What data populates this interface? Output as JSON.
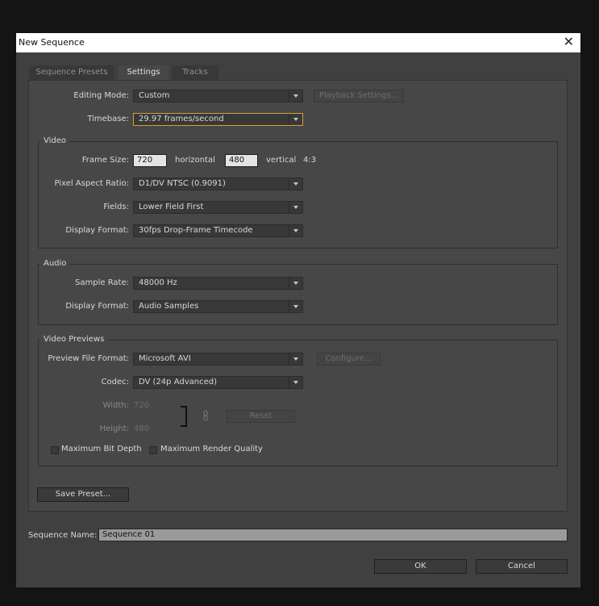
{
  "window": {
    "title": "New Sequence"
  },
  "tabs": [
    {
      "label": "Sequence Presets",
      "active": false
    },
    {
      "label": "Settings",
      "active": true
    },
    {
      "label": "Tracks",
      "active": false
    }
  ],
  "general": {
    "editing_mode_label": "Editing Mode:",
    "editing_mode_value": "Custom",
    "playback_settings_label": "Playback Settings...",
    "timebase_label": "Timebase:",
    "timebase_value": "29.97 frames/second"
  },
  "video": {
    "legend": "Video",
    "frame_size_label": "Frame Size:",
    "frame_width": "720",
    "horizontal_label": "horizontal",
    "frame_height": "480",
    "vertical_label": "vertical",
    "aspect": "4:3",
    "pixel_aspect_label": "Pixel Aspect Ratio:",
    "pixel_aspect_value": "D1/DV NTSC (0.9091)",
    "fields_label": "Fields:",
    "fields_value": "Lower Field First",
    "display_format_label": "Display Format:",
    "display_format_value": "30fps Drop-Frame Timecode"
  },
  "audio": {
    "legend": "Audio",
    "sample_rate_label": "Sample Rate:",
    "sample_rate_value": "48000 Hz",
    "display_format_label": "Display Format:",
    "display_format_value": "Audio Samples"
  },
  "previews": {
    "legend": "Video Previews",
    "file_format_label": "Preview File Format:",
    "file_format_value": "Microsoft AVI",
    "configure_label": "Configure...",
    "codec_label": "Codec:",
    "codec_value": "DV (24p Advanced)",
    "width_label": "Width:",
    "width_value": "720",
    "height_label": "Height:",
    "height_value": "480",
    "reset_label": "Reset",
    "max_bit_depth_label": "Maximum Bit Depth",
    "max_render_quality_label": "Maximum Render Quality"
  },
  "save_preset_label": "Save Preset...",
  "sequence_name_label": "Sequence Name:",
  "sequence_name_value": "Sequence 01",
  "ok_label": "OK",
  "cancel_label": "Cancel",
  "colors": {
    "focus_border": "#d6a233",
    "panel": "#474747",
    "window": "#404040"
  }
}
